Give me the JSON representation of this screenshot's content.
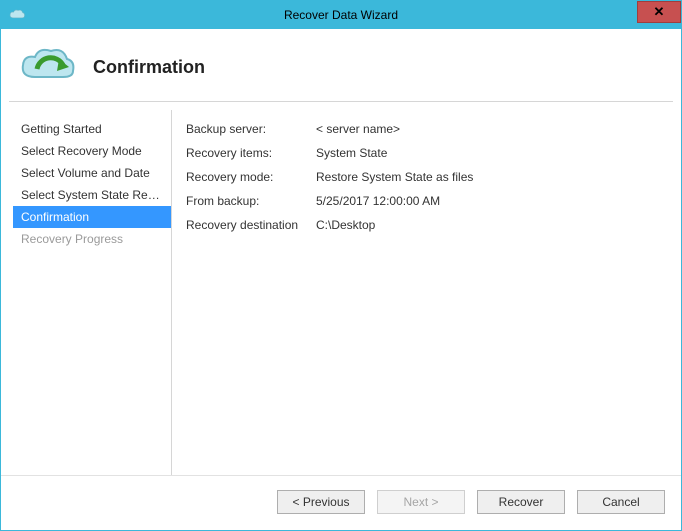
{
  "window": {
    "title": "Recover Data Wizard"
  },
  "header": {
    "heading": "Confirmation"
  },
  "sidebar": {
    "items": [
      {
        "label": "Getting Started"
      },
      {
        "label": "Select Recovery Mode"
      },
      {
        "label": "Select Volume and Date"
      },
      {
        "label": "Select System State Reco..."
      },
      {
        "label": "Confirmation"
      },
      {
        "label": "Recovery Progress"
      }
    ]
  },
  "details": {
    "backup_server_label": "Backup server:",
    "backup_server_value": "< server name>",
    "recovery_items_label": "Recovery items:",
    "recovery_items_value": "System State",
    "recovery_mode_label": "Recovery mode:",
    "recovery_mode_value": "Restore System State as files",
    "from_backup_label": "From backup:",
    "from_backup_value": "5/25/2017 12:00:00 AM",
    "recovery_destination_label": "Recovery destination",
    "recovery_destination_value": "C:\\Desktop"
  },
  "buttons": {
    "previous": "< Previous",
    "next": "Next >",
    "recover": "Recover",
    "cancel": "Cancel"
  }
}
